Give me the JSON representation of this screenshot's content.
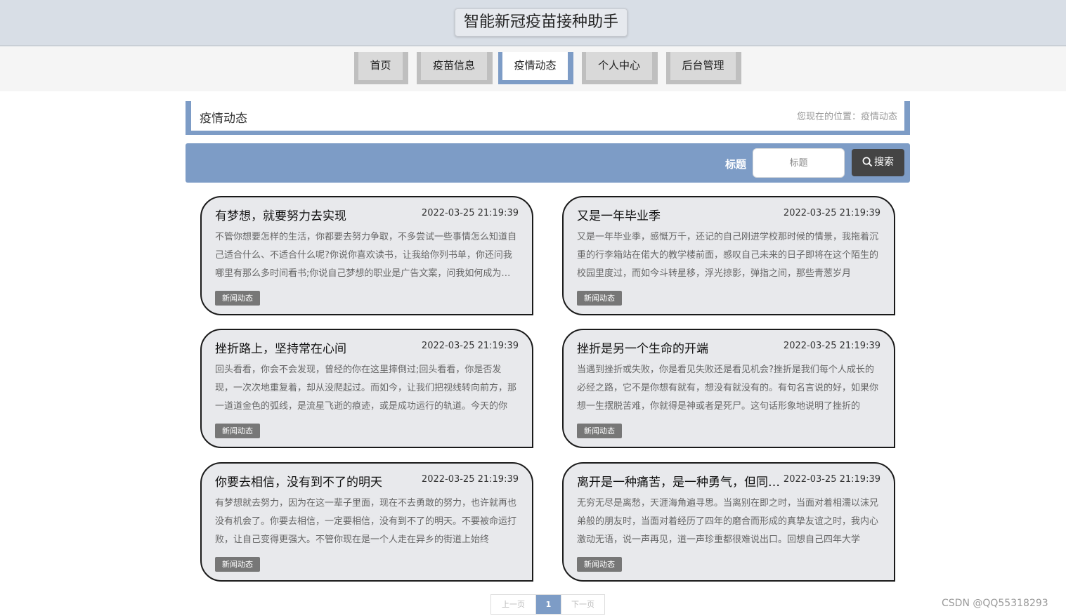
{
  "site": {
    "title": "智能新冠疫苗接种助手"
  },
  "nav": [
    {
      "label": "首页",
      "active": false
    },
    {
      "label": "疫苗信息",
      "active": false
    },
    {
      "label": "疫情动态",
      "active": true
    },
    {
      "label": "个人中心",
      "active": false
    },
    {
      "label": "后台管理",
      "active": false
    }
  ],
  "header": {
    "title": "疫情动态",
    "breadcrumb": "您现在的位置：疫情动态"
  },
  "search": {
    "label": "标题",
    "placeholder": "标题",
    "button": "搜索"
  },
  "articles": [
    {
      "title": "有梦想，就要努力去实现",
      "date": "2022-03-25 21:19:39",
      "summary": "不管你想要怎样的生活，你都要去努力争取，不多尝试一些事情怎么知道自己适合什么、不适合什么呢?你说你喜欢读书，让我给你列书单，你还问我哪里有那么多时间看书;你说自己梦想的职业是广告文案，问我如何成为一名优秀的文案",
      "tag": "新闻动态"
    },
    {
      "title": "又是一年毕业季",
      "date": "2022-03-25 21:19:39",
      "summary": "又是一年毕业季，感慨万千，还记的自己刚进学校那时候的情景，我拖着沉重的行李箱站在偌大的教学楼前面，感叹自己未来的日子即将在这个陌生的校园里度过，而如今斗转星移，浮光掠影，弹指之间，那些青葱岁月",
      "tag": "新闻动态"
    },
    {
      "title": "挫折路上，坚持常在心间",
      "date": "2022-03-25 21:19:39",
      "summary": "回头看看，你会不会发现，曾经的你在这里摔倒过;回头看看，你是否发现，一次次地重复着，却从没爬起过。而如今，让我们把视线转向前方，那一道道金色的弧线，是流星飞逝的痕迹，或是成功运行的轨道。今天的你",
      "tag": "新闻动态"
    },
    {
      "title": "挫折是另一个生命的开端",
      "date": "2022-03-25 21:19:39",
      "summary": "当遇到挫折或失败，你是看见失败还是看见机会?挫折是我们每个人成长的必经之路，它不是你想有就有，想没有就没有的。有句名言说的好，如果你想一生摆脱苦难，你就得是神或者是死尸。这句话形象地说明了挫折的",
      "tag": "新闻动态"
    },
    {
      "title": "你要去相信，没有到不了的明天",
      "date": "2022-03-25 21:19:39",
      "summary": "有梦想就去努力，因为在这一辈子里面，现在不去勇敢的努力，也许就再也没有机会了。你要去相信，一定要相信，没有到不了的明天。不要被命运打败，让自己变得更强大。不管你现在是一个人走在异乡的街道上始终",
      "tag": "新闻动态"
    },
    {
      "title": "离开是一种痛苦，是一种勇气，但同样也是一个考验",
      "date": "2022-03-25 21:19:39",
      "summary": "无穷无尽是离愁，天涯海角遍寻思。当离别在即之时，当面对着相濡以沫兄弟般的朋友时，当面对着经历了四年的磨合而形成的真挚友谊之时，我内心激动无语，说一声再见，道一声珍重都很难说出口。回想自己四年大学",
      "tag": "新闻动态"
    }
  ],
  "pager": {
    "prev": "上一页",
    "current": "1",
    "next": "下一页"
  },
  "watermark": "CSDN @QQ55318293"
}
